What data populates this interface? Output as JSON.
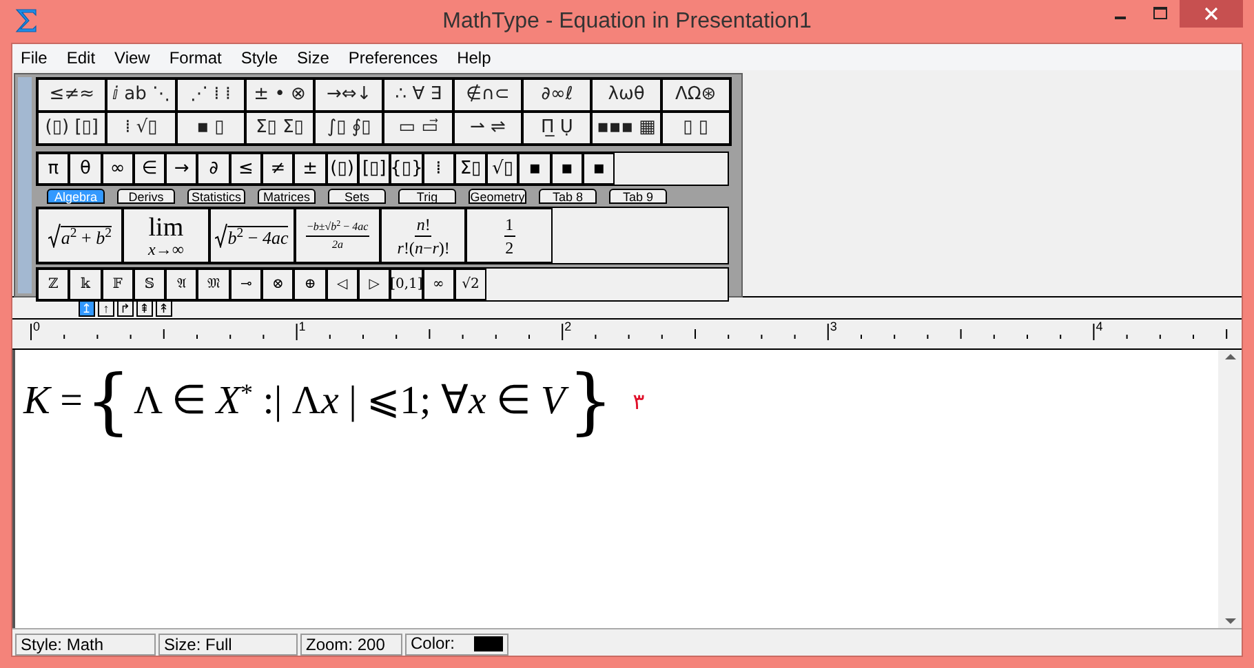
{
  "window": {
    "title": "MathType - Equation in Presentation1"
  },
  "menu": [
    "File",
    "Edit",
    "View",
    "Format",
    "Style",
    "Size",
    "Preferences",
    "Help"
  ],
  "palette_rows": [
    [
      "≤≠≈",
      "ⅈ ab ⋱",
      "⋰ ⁞ ⁞",
      "± • ⊗",
      "→⇔↓",
      "∴ ∀ ∃",
      "∉∩⊂",
      "∂∞ℓ",
      "λωθ",
      "ΛΩ⊛"
    ],
    [
      "(▯) [▯]",
      "⁞ √▯",
      "▪ ▯",
      "Σ▯ Σ▯",
      "∫▯ ∮▯",
      "▭ ▭⃗",
      "⇀ ⇌",
      "Π̲ Ụ",
      "▪▪▪ ▦",
      "▯ ▯"
    ]
  ],
  "symbol_bar": [
    "π",
    "θ",
    "∞",
    "∈",
    "→",
    "∂",
    "≤",
    "≠",
    "±",
    "(▯)",
    "[▯]",
    "{▯}",
    "⁞",
    "Σ▯",
    "√▯",
    "▪",
    "▪",
    "▪"
  ],
  "tabs": [
    {
      "label": "Algebra",
      "selected": true
    },
    {
      "label": "Derivs",
      "selected": false
    },
    {
      "label": "Statistics",
      "selected": false
    },
    {
      "label": "Matrices",
      "selected": false
    },
    {
      "label": "Sets",
      "selected": false
    },
    {
      "label": "Trig",
      "selected": false
    },
    {
      "label": "Geometry",
      "selected": false
    },
    {
      "label": "Tab 8",
      "selected": false
    },
    {
      "label": "Tab 9",
      "selected": false
    }
  ],
  "templates": [
    {
      "kind": "sqrt",
      "body": "*a*$^{2}$ + *b*$^{2}$"
    },
    {
      "kind": "limit",
      "top": "lim",
      "bottom": "*x*→∞"
    },
    {
      "kind": "sqrt",
      "body": "*b*$^{2}$ − *4ac*"
    },
    {
      "kind": "fraction",
      "numerator": "−*b*±√*b*$^{2}$ − *4ac*",
      "denominator": "*2a*",
      "small": true
    },
    {
      "kind": "fraction",
      "numerator": "*n*!",
      "denominator": "*r*!(*n*−*r*)!",
      "small": false
    },
    {
      "kind": "fraction",
      "numerator": "1",
      "denominator": "2",
      "small": false
    }
  ],
  "symbol_bar_2": [
    "ℤ",
    "𝕜",
    "𝔽",
    "𝕊",
    "𝔄",
    "𝔐",
    "⊸",
    "⊗",
    "⊕",
    "◁",
    "▷",
    "[0,1]",
    "∞",
    "√2"
  ],
  "nudge_buttons": [
    {
      "label": "↥",
      "selected": true
    },
    {
      "label": "↑",
      "selected": false
    },
    {
      "label": "↱",
      "selected": false
    },
    {
      "label": "⇞",
      "selected": false
    },
    {
      "label": "↟",
      "selected": false
    }
  ],
  "ruler": {
    "labels": [
      "0",
      "1",
      "2",
      "3",
      "4"
    ]
  },
  "equation": {
    "open": "{",
    "body": [
      {
        "text": "K",
        "italic": true
      },
      {
        "text": " = ",
        "italic": false
      }
    ],
    "inner": [
      {
        "text": "Λ ∈ ",
        "italic": false
      },
      {
        "text": "X",
        "italic": true
      },
      {
        "text": "*",
        "italic": false,
        "raised": true
      },
      {
        "text": " :| Λ",
        "italic": false
      },
      {
        "text": "x",
        "italic": true
      },
      {
        "text": " | ⩽1; ∀",
        "italic": false
      },
      {
        "text": "x",
        "italic": true
      },
      {
        "text": " ∈ ",
        "italic": false
      },
      {
        "text": "V",
        "italic": true
      }
    ],
    "close": "}",
    "number": "٣"
  },
  "status_bar": {
    "style": "Style: Math",
    "size": "Size: Full",
    "zoom": "Zoom: 200",
    "color_label": "Color:",
    "color": "#000000"
  }
}
